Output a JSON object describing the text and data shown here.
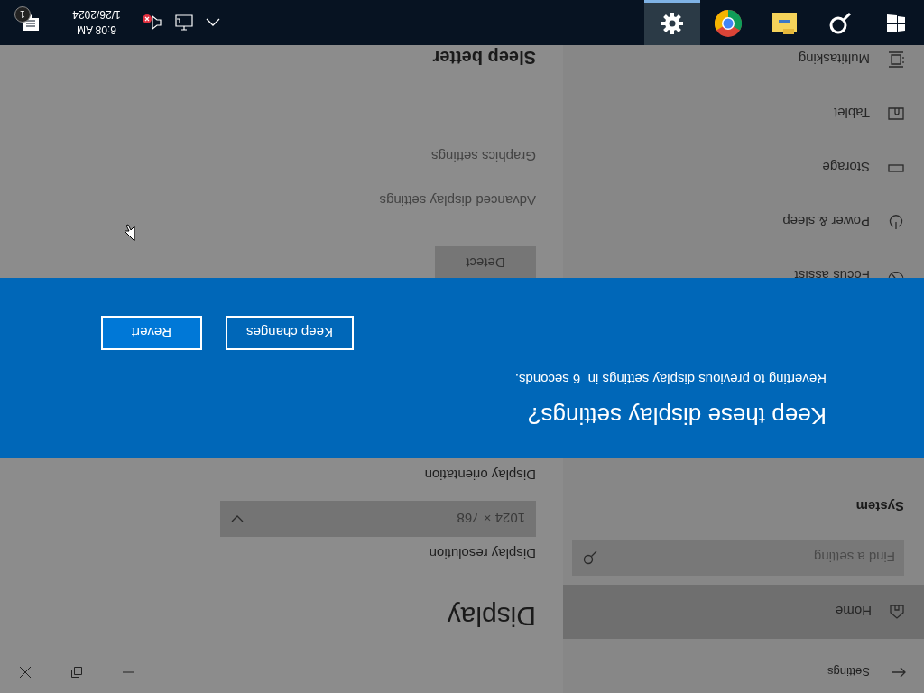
{
  "window": {
    "title": "Settings"
  },
  "sidebar": {
    "home": {
      "label": "Home",
      "highlighted": true
    },
    "search": {
      "placeholder": "Find a setting"
    },
    "heading": "System",
    "items": [
      {
        "label": "Focus assist",
        "selected": false
      },
      {
        "label": "Power & sleep",
        "selected": false
      },
      {
        "label": "Storage",
        "selected": false
      },
      {
        "label": "Tablet",
        "selected": false
      },
      {
        "label": "Multitasking",
        "selected": false
      }
    ]
  },
  "content": {
    "title": "Display",
    "resolution_label": "Display resolution",
    "resolution": "1024 × 768",
    "orientation_label": "Display orientation",
    "detect_button": "Detect",
    "links": [
      "Advanced display settings",
      "Graphics settings"
    ],
    "section": "Sleep better"
  },
  "dialog": {
    "title": "Keep these display settings?",
    "message": "Reverting to previous display settings in  6 seconds.",
    "buttons": [
      {
        "label": "Keep changes",
        "primary": false
      },
      {
        "label": "Revert",
        "primary": true
      }
    ]
  },
  "taskbar": {
    "apps": [
      {
        "selected": false
      },
      {
        "selected": false
      },
      {
        "selected": false
      },
      {
        "selected": false
      },
      {
        "selected": true
      }
    ],
    "volume_muted": true,
    "time": "6:08 AM",
    "date": "1/26/2024",
    "notification_badge": "1"
  }
}
